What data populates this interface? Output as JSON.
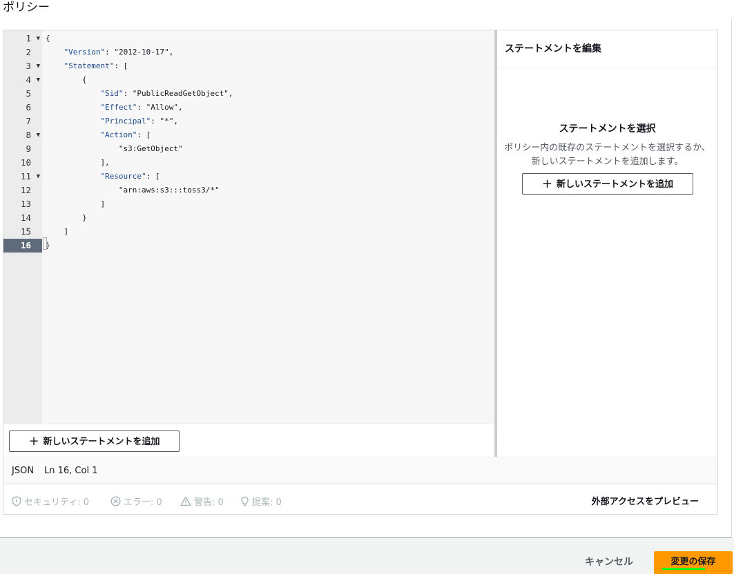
{
  "page": {
    "title": "ポリシー"
  },
  "editor": {
    "lines": [
      {
        "n": "1",
        "fold": true,
        "text": "{"
      },
      {
        "n": "2",
        "fold": false,
        "indent": 4,
        "key": "\"Version\"",
        "rest": ": \"2012-10-17\","
      },
      {
        "n": "3",
        "fold": true,
        "indent": 4,
        "key": "\"Statement\"",
        "rest": ": ["
      },
      {
        "n": "4",
        "fold": true,
        "indent": 8,
        "text": "{"
      },
      {
        "n": "5",
        "fold": false,
        "indent": 12,
        "key": "\"Sid\"",
        "rest": ": \"PublicReadGetObject\","
      },
      {
        "n": "6",
        "fold": false,
        "indent": 12,
        "key": "\"Effect\"",
        "rest": ": \"Allow\","
      },
      {
        "n": "7",
        "fold": false,
        "indent": 12,
        "key": "\"Principal\"",
        "rest": ": \"*\","
      },
      {
        "n": "8",
        "fold": true,
        "indent": 12,
        "key": "\"Action\"",
        "rest": ": ["
      },
      {
        "n": "9",
        "fold": false,
        "indent": 16,
        "text": "\"s3:GetObject\""
      },
      {
        "n": "10",
        "fold": false,
        "indent": 12,
        "text": "],"
      },
      {
        "n": "11",
        "fold": true,
        "indent": 12,
        "key": "\"Resource\"",
        "rest": ": ["
      },
      {
        "n": "12",
        "fold": false,
        "indent": 16,
        "text": "\"arn:aws:s3:::toss3/*\""
      },
      {
        "n": "13",
        "fold": false,
        "indent": 12,
        "text": "]"
      },
      {
        "n": "14",
        "fold": false,
        "indent": 8,
        "text": "}"
      },
      {
        "n": "15",
        "fold": false,
        "indent": 4,
        "text": "]"
      },
      {
        "n": "16",
        "fold": false,
        "text": "}",
        "active": true
      }
    ],
    "add_statement_label": "新しいステートメントを追加"
  },
  "side_panel": {
    "title": "ステートメントを編集",
    "select_title": "ステートメントを選択",
    "select_desc": "ポリシー内の既存のステートメントを選択するか、新しいステートメントを追加します。",
    "add_statement_label": "新しいステートメントを追加"
  },
  "status": {
    "mode": "JSON",
    "position": "Ln 16, Col 1"
  },
  "checks": {
    "security": "セキュリティ: 0",
    "errors": "エラー: 0",
    "warnings": "警告: 0",
    "suggestions": "提案: 0",
    "preview_label": "外部アクセスをプレビュー"
  },
  "footer": {
    "cancel_label": "キャンセル",
    "save_label": "変更の保存"
  },
  "colors": {
    "accent": "#ff9900",
    "highlight": "#1aff1a"
  }
}
